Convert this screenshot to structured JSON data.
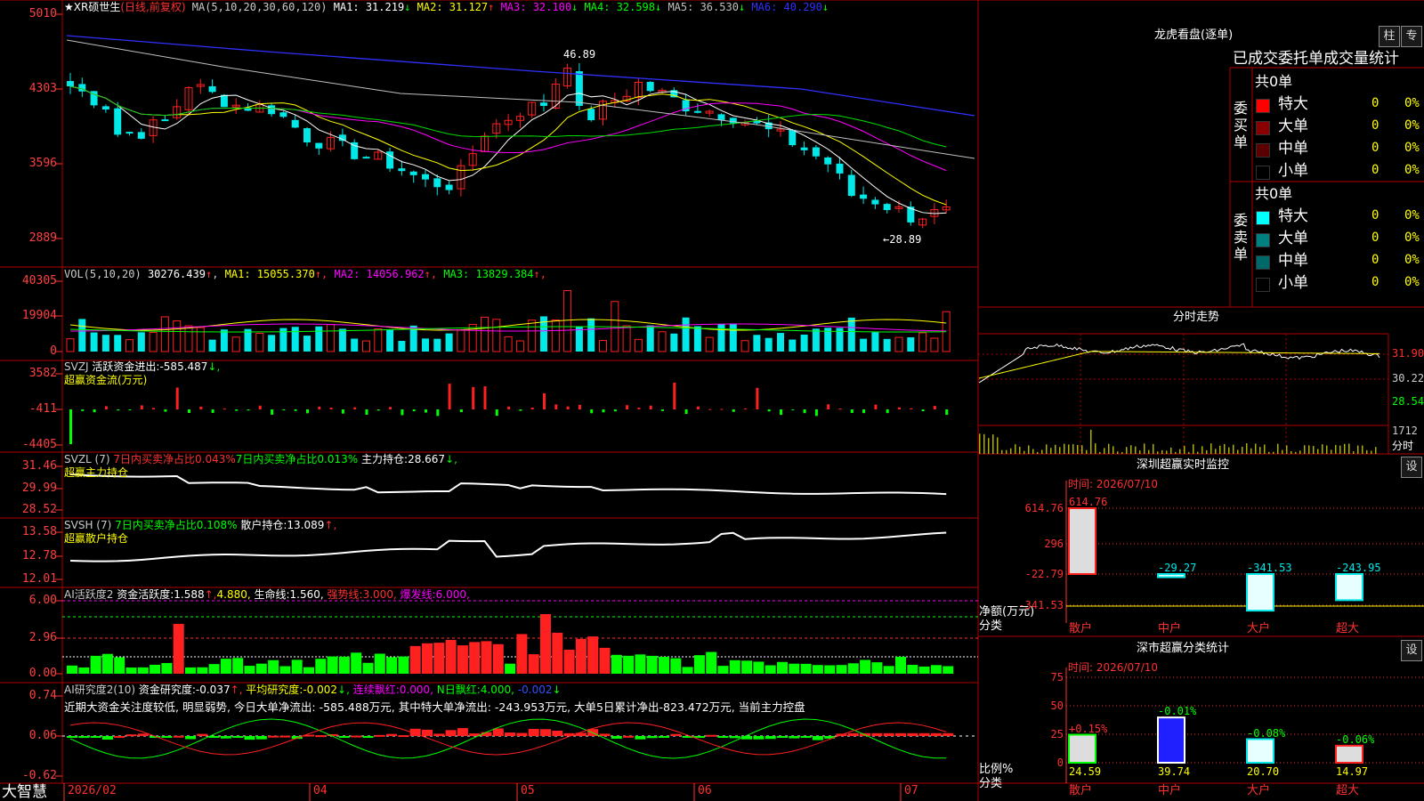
{
  "brand": "大智慧",
  "colors": {
    "up": "#ff2020",
    "down": "#00e8e8",
    "grid": "#b00000"
  },
  "main": {
    "stock": "★XR硕世生",
    "period": "(日线,前复权)",
    "ma_label": "MA(5,10,20,30,60,120)",
    "ma": [
      {
        "label": "MA1:",
        "value": "31.219",
        "arrow": "↓",
        "color": "#ffffff"
      },
      {
        "label": "MA2:",
        "value": "31.127",
        "arrow": "↑",
        "color": "#ffff00"
      },
      {
        "label": "MA3:",
        "value": "32.100",
        "arrow": "↓",
        "color": "#ff00ff"
      },
      {
        "label": "MA4:",
        "value": "32.598",
        "arrow": "↓",
        "color": "#00ff00"
      },
      {
        "label": "MA5:",
        "value": "36.530",
        "arrow": "↓",
        "color": "#c0c0c0"
      },
      {
        "label": "MA6:",
        "value": "40.290",
        "arrow": "↓",
        "color": "#3030ff"
      }
    ],
    "y_ticks": [
      "5010",
      "4303",
      "3596",
      "2889"
    ],
    "high_label": "46.89",
    "low_label": "←28.89"
  },
  "vol": {
    "label": "VOL(5,10,20)",
    "value": "30276.439",
    "arrow": "↑",
    "ma": [
      {
        "label": "MA1:",
        "value": "15055.370",
        "arrow": "↑",
        "color": "#ffff00"
      },
      {
        "label": "MA2:",
        "value": "14056.962",
        "arrow": "↑",
        "color": "#ff00ff"
      },
      {
        "label": "MA3:",
        "value": "13829.384",
        "arrow": "↑",
        "color": "#00ff00"
      }
    ],
    "y_ticks": [
      "40305",
      "19904",
      "0"
    ]
  },
  "svzj": {
    "label": "SVZJ",
    "desc": "活跃资金进出:",
    "value": "-585.487",
    "arrow": "↓,",
    "sub": "超赢资金流(万元)",
    "y_ticks": [
      "3582",
      "-411",
      "-4405"
    ]
  },
  "svzl": {
    "label": "SVZL (7)",
    "a": "7日内买卖净占比0.043%",
    "b": "7日内买卖净占比0.013%",
    "c": "主力持仓:",
    "value": "28.667",
    "arrow": "↓,",
    "sub": "超赢主力持仓",
    "y_ticks": [
      "31.46",
      "29.99",
      "28.52"
    ]
  },
  "svsh": {
    "label": "SVSH (7)",
    "a": "7日内买卖净占比0.108%",
    "c": "散户持仓:",
    "value": "13.089",
    "arrow": "↑,",
    "sub": "超赢散户持仓",
    "y_ticks": [
      "13.58",
      "12.78",
      "12.01"
    ]
  },
  "ai1": {
    "label": "AI活跃度2",
    "a": "资金活跃度:",
    "av": "1.588",
    "a2": "4.880,",
    "b": "生命线:",
    "bv": "1.560,",
    "c": "强势线:",
    "cv": "3.000,",
    "d": "爆发线:",
    "dv": "6.000,",
    "y_ticks": [
      "6.00",
      "2.96",
      "0.00"
    ]
  },
  "ai2": {
    "label": "AI研究度2(10)",
    "a": "资金研究度:",
    "av": "-0.037",
    "b": "平均研究度:",
    "bv": "-0.002",
    "c": "连续飘红:",
    "cv": "0.000,",
    "d": "N日飘红:",
    "dv": "4.000,",
    "e": "-0.002",
    "comment": "近期大资金关注度较低, 明显弱势, 今日大单净流出: -585.488万元, 其中特大单净流出: -243.953万元, 大单5日累计净出-823.472万元, 当前主力控盘",
    "y_ticks": [
      "0.74",
      "0.06",
      "-0.62"
    ]
  },
  "x_axis": [
    "2026/02",
    "04",
    "05",
    "06",
    "07"
  ],
  "lhb": {
    "title": "龙虎看盘(逐单)",
    "btn1": "柱",
    "btn2": "专",
    "tabs": "已成交委托单成交量统计",
    "buy": {
      "side": "委买单",
      "total": "共0单",
      "rows": [
        {
          "name": "特大",
          "count": "0",
          "pct": "0%",
          "color": "#ff0000"
        },
        {
          "name": "大单",
          "count": "0",
          "pct": "0%",
          "color": "#8a0000"
        },
        {
          "name": "中单",
          "count": "0",
          "pct": "0%",
          "color": "#5a0000"
        },
        {
          "name": "小单",
          "count": "0",
          "pct": "0%",
          "color": "#000000"
        }
      ]
    },
    "sell": {
      "side": "委卖单",
      "total": "共0单",
      "rows": [
        {
          "name": "特大",
          "count": "0",
          "pct": "0%",
          "color": "#00ffff"
        },
        {
          "name": "大单",
          "count": "0",
          "pct": "0%",
          "color": "#008080"
        },
        {
          "name": "中单",
          "count": "0",
          "pct": "0%",
          "color": "#006868"
        },
        {
          "name": "小单",
          "count": "0",
          "pct": "0%",
          "color": "#000000"
        }
      ]
    }
  },
  "fenshi": {
    "title": "分时走势",
    "y_ticks": [
      "31.90",
      "30.22",
      "28.54"
    ],
    "vol_tick": "1712",
    "vol_label": "分时"
  },
  "sz_monitor": {
    "title": "深圳超赢实时监控",
    "btn": "设",
    "time": "时间: 2026/07/10",
    "y_ticks": [
      "614.76",
      "296",
      "-22.79",
      "-341.53"
    ],
    "axis_label": "净额(万元)",
    "cat_label": "分类",
    "bars": [
      {
        "cat": "散户",
        "value": "614.76"
      },
      {
        "cat": "中户",
        "value": "-29.27"
      },
      {
        "cat": "大户",
        "value": "-341.53"
      },
      {
        "cat": "超大",
        "value": "-243.95"
      }
    ]
  },
  "sz_class": {
    "title": "深市超赢分类统计",
    "btn": "设",
    "time": "时间: 2026/07/10",
    "y_ticks": [
      "75",
      "50",
      "25",
      "0"
    ],
    "axis_label": "比例%",
    "cat_label": "分类",
    "bars": [
      {
        "cat": "散户",
        "top": "+0.15%",
        "value": "24.59"
      },
      {
        "cat": "中户",
        "top": "-0.01%",
        "value": "39.74"
      },
      {
        "cat": "大户",
        "top": "-0.08%",
        "value": "20.70"
      },
      {
        "cat": "超大",
        "top": "-0.06%",
        "value": "14.97"
      }
    ]
  }
}
